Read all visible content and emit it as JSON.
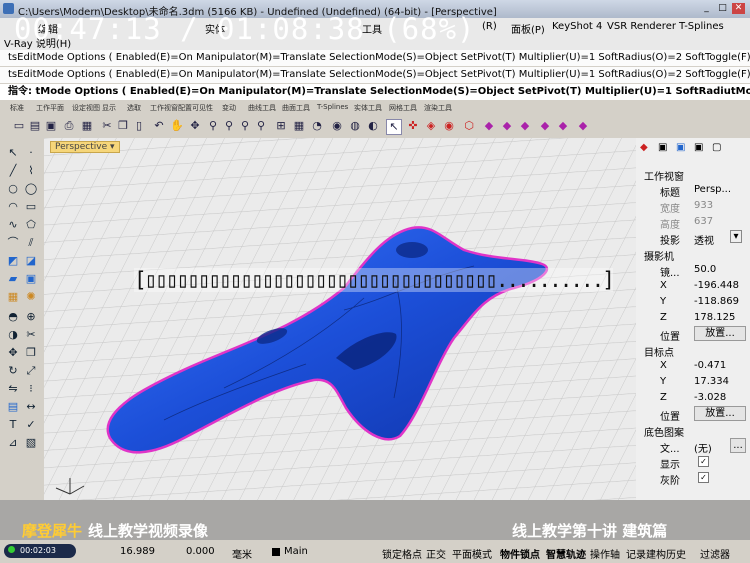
{
  "window": {
    "title": "C:\\Users\\Modern\\Desktop\\未命名.3dm (5166 KB) - Undefined (Undefined) (64-bit) - [Perspective]"
  },
  "menu": {
    "items": [
      "编辑",
      "实体",
      "工具",
      "(R)",
      "面板(P)",
      "KeyShot 4",
      "VSR Renderer",
      "T-Splines"
    ],
    "line2": "V-Ray   说明(H)"
  },
  "command": {
    "line1": "tsEditMode Options ( Enabled(E)=On  Manipulator(M)=Translate  SelectionMode(S)=Object  SetPivot(T)  Multiplier(U)=1  SoftRadius(O)=2  SoftToggle(F)",
    "line2": "tsEditMode Options ( Enabled(E)=On  Manipulator(M)=Translate  SelectionMode(S)=Object  SetPivot(T)  Multiplier(U)=1  SoftRadius(O)=2  SoftToggle(F)",
    "prompt": "指令: tMode Options ( Enabled(E)=On  Manipulator(M)=Translate  SelectionMode(S)=Object  SetPivot(T)  Multiplier(U)=1  SoftRadiutMode Options ( Enabled(E)=On"
  },
  "tabs": [
    "标准",
    "工作平面",
    "设定视图",
    "显示",
    "选取",
    "工作视窗配置",
    "可见性",
    "变动",
    "曲线工具",
    "曲面工具",
    "T-Splines",
    "实体工具",
    "网格工具",
    "渲染工具"
  ],
  "viewport": {
    "label": "Perspective"
  },
  "overlay": {
    "timer": "00:47:13 / 01:08:38 (68%)",
    "progress_text": "[▯▯▯▯▯▯▯▯▯▯▯▯▯▯▯▯▯▯▯▯▯▯▯▯▯▯▯▯▯▯▯▯▯..........]",
    "progress_fraction": 0.68,
    "brand": "摩登犀牛",
    "tagline": "线上教学视频录像",
    "lesson": "线上教学第十讲  建筑篇"
  },
  "panel": {
    "section_viewport": "工作视窗",
    "title_label": "标题",
    "title_value": "Persp...",
    "width_label": "宽度",
    "width_value": "933",
    "height_label": "高度",
    "height_value": "637",
    "projection_label": "投影",
    "projection_value": "透视",
    "section_camera": "摄影机",
    "lens_label": "镜...",
    "lens_value": "50.0",
    "cx_label": "X",
    "cx_value": "-196.448",
    "cy_label": "Y",
    "cy_value": "-118.869",
    "cz_label": "Z",
    "cz_value": "178.125",
    "cpos_label": "位置",
    "cpos_button": "放置...",
    "section_target": "目标点",
    "tx_label": "X",
    "tx_value": "-0.471",
    "ty_label": "Y",
    "ty_value": "17.334",
    "tz_label": "Z",
    "tz_value": "-3.028",
    "tpos_label": "位置",
    "tpos_button": "放置...",
    "section_wallpaper": "底色图案",
    "file_label": "文...",
    "file_value": "(无)",
    "file_button": "...",
    "show_label": "显示",
    "gray_label": "灰阶",
    "show_checked": true,
    "gray_checked": true
  },
  "status": {
    "record_time": "00:02:03",
    "y_value": "16.989",
    "z_value": "0.000",
    "unit": "毫米",
    "layer": "Main",
    "toggles": [
      "锁定格点",
      "正交",
      "平面模式",
      "物件锁点",
      "智慧轨迹",
      "操作轴",
      "记录建构历史",
      "过滤器"
    ]
  },
  "colors": {
    "model": "#1a4fd6",
    "model_edge": "#e034c8",
    "accent": "#f6d67a"
  }
}
